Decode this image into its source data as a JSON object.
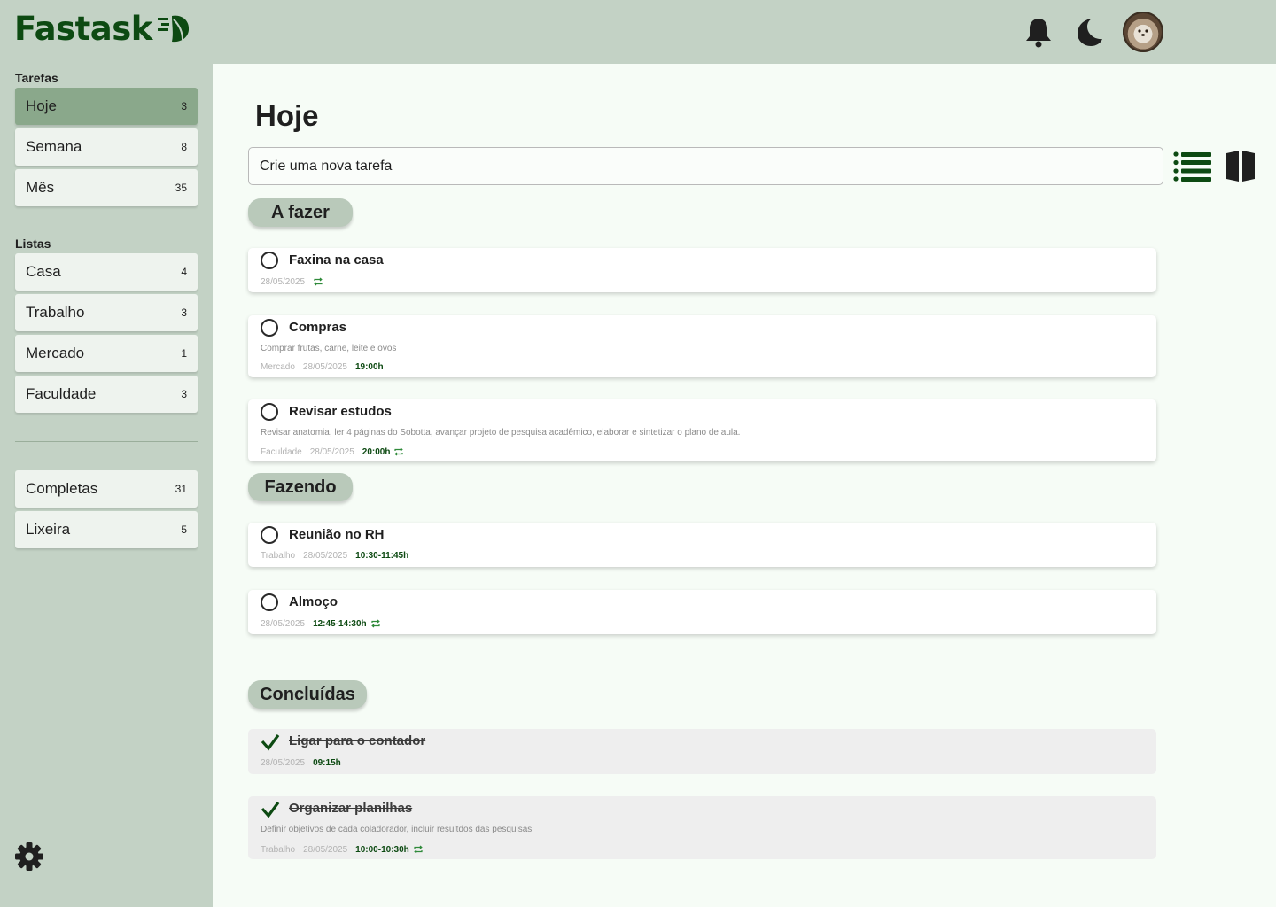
{
  "app": {
    "name": "Fastask"
  },
  "sidebar": {
    "tasks_label": "Tarefas",
    "tasks": [
      {
        "label": "Hoje",
        "count": "3"
      },
      {
        "label": "Semana",
        "count": "8"
      },
      {
        "label": "Mês",
        "count": "35"
      }
    ],
    "lists_label": "Listas",
    "lists": [
      {
        "label": "Casa",
        "count": "4"
      },
      {
        "label": "Trabalho",
        "count": "3"
      },
      {
        "label": "Mercado",
        "count": "1"
      },
      {
        "label": "Faculdade",
        "count": "3"
      }
    ],
    "extras": [
      {
        "label": "Completas",
        "count": "31"
      },
      {
        "label": "Lixeira",
        "count": "5"
      }
    ]
  },
  "main": {
    "title": "Hoje",
    "new_task_placeholder": "Crie uma nova tarefa",
    "groups": {
      "todo": "A fazer",
      "doing": "Fazendo",
      "done": "Concluídas"
    },
    "todo": [
      {
        "title": "Faxina na casa",
        "date": "28/05/2025",
        "repeat": true
      },
      {
        "title": "Compras",
        "desc": "Comprar frutas, carne, leite e ovos",
        "list": "Mercado",
        "date": "28/05/2025",
        "time": "19:00h"
      },
      {
        "title": "Revisar estudos",
        "desc": "Revisar anatomia, ler  4 páginas do Sobotta, avançar projeto de pesquisa acadêmico, elaborar e sintetizar o plano de aula.",
        "list": "Faculdade",
        "date": "28/05/2025",
        "time": "20:00h",
        "repeat": true
      }
    ],
    "doing": [
      {
        "title": "Reunião no RH",
        "list": "Trabalho",
        "date": "28/05/2025",
        "time": "10:30-11:45h"
      },
      {
        "title": "Almoço",
        "date": "28/05/2025",
        "time": "12:45-14:30h",
        "repeat": true
      }
    ],
    "done": [
      {
        "title": "Ligar para o contador",
        "date": "28/05/2025",
        "time": "09:15h"
      },
      {
        "title": "Organizar planilhas",
        "desc": "Definir objetivos de cada coladorador, incluir resultdos das pesquisas",
        "list": "Trabalho",
        "date": "28/05/2025",
        "time": "10:00-10:30h",
        "repeat": true
      }
    ]
  },
  "colors": {
    "brand": "#0d4a12",
    "sidebar_bg": "#c3d2c5",
    "active_item": "#8aa88b",
    "main_bg": "#f6fcf6"
  }
}
